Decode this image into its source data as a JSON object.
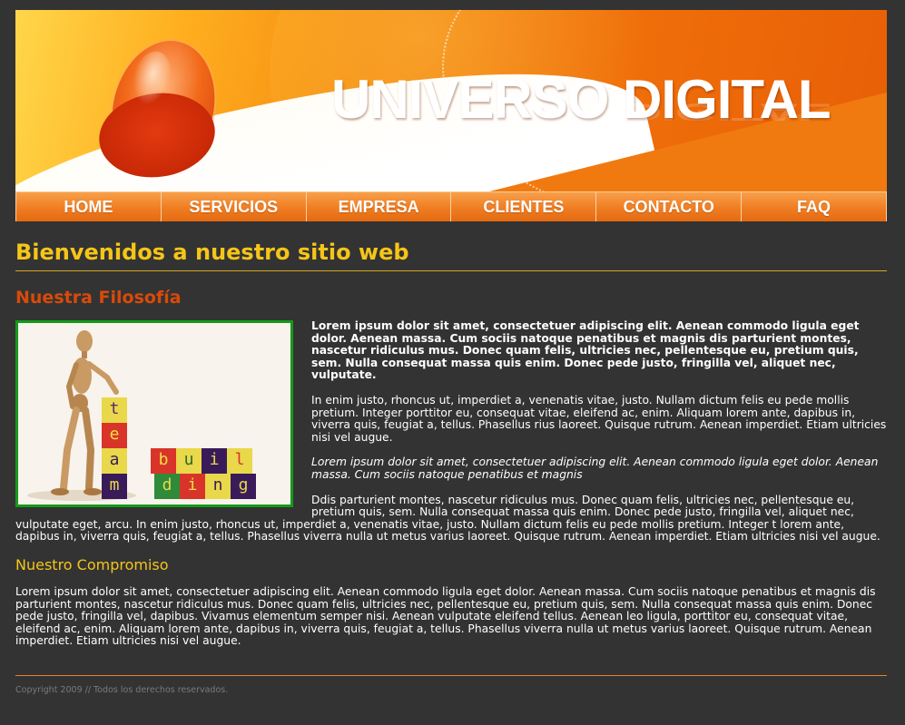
{
  "banner": {
    "title": "UNIVERSO DIGITAL"
  },
  "nav": {
    "items": [
      "HOME",
      "SERVICIOS",
      "EMPRESA",
      "CLIENTES",
      "CONTACTO",
      "FAQ"
    ]
  },
  "content": {
    "welcome_title": "Bienvenidos a nuestro sitio web",
    "philosophy_title": "Nuestra Filosofía",
    "photo_letters": {
      "column": [
        "t",
        "e",
        "a",
        "m"
      ],
      "bottom": [
        "b",
        "u",
        "i",
        "l",
        "d",
        "i",
        "n",
        "g"
      ]
    },
    "lead": "Lorem ipsum dolor sit amet, consectetuer adipiscing elit. Aenean commodo ligula eget dolor. Aenean massa. Cum sociis natoque penatibus et magnis dis parturient montes, nascetur ridiculus mus. Donec quam felis, ultricies nec, pellentesque eu, pretium quis, sem. Nulla consequat massa quis enim. Donec pede justo, fringilla vel, aliquet nec, vulputate.",
    "para1": "In enim justo, rhoncus ut, imperdiet a, venenatis vitae, justo. Nullam dictum felis eu pede mollis pretium. Integer porttitor eu, consequat vitae, eleifend ac, enim. Aliquam lorem ante, dapibus in, viverra quis, feugiat a, tellus. Phasellus rius laoreet. Quisque rutrum. Aenean imperdiet. Etiam ultricies nisi vel augue.",
    "italic": "Lorem ipsum dolor sit amet, consectetuer adipiscing elit. Aenean commodo ligula eget dolor. Aenean massa. Cum sociis natoque penatibus et magnis",
    "para2": "Ddis parturient montes, nascetur ridiculus mus. Donec quam felis, ultricies nec, pellentesque eu, pretium quis, sem. Nulla consequat massa quis enim. Donec pede justo, fringilla vel, aliquet nec, vulputate eget, arcu. In enim justo, rhoncus ut, imperdiet a, venenatis vitae, justo. Nullam dictum felis eu pede mollis pretium. Integer t lorem ante, dapibus in, viverra quis, feugiat a, tellus. Phasellus viverra nulla ut metus varius laoreet. Quisque rutrum. Aenean imperdiet. Etiam ultricies nisi vel augue.",
    "commitment_title": "Nuestro Compromiso",
    "commitment_text": "Lorem ipsum dolor sit amet, consectetuer adipiscing elit. Aenean commodo ligula eget dolor. Aenean massa. Cum sociis natoque penatibus et magnis dis parturient montes, nascetur ridiculus mus. Donec quam felis, ultricies nec, pellentesque eu, pretium quis, sem. Nulla consequat massa quis enim. Donec pede justo, fringilla vel, dapibus. Vivamus elementum semper nisi. Aenean vulputate eleifend tellus. Aenean leo ligula, porttitor eu, consequat vitae, eleifend ac, enim. Aliquam lorem ante, dapibus in, viverra quis, feugiat a, tellus. Phasellus viverra nulla ut metus varius laoreet. Quisque rutrum. Aenean imperdiet. Etiam ultricies nisi vel augue."
  },
  "footer": {
    "copyright": "Copyright 2009 // Todos los derechos reservados."
  },
  "colors": {
    "background": "#333333",
    "heading_yellow": "#f5c518",
    "heading_red": "#d84a0a",
    "nav_orange": "#f07d22",
    "photo_border": "#159a18"
  }
}
